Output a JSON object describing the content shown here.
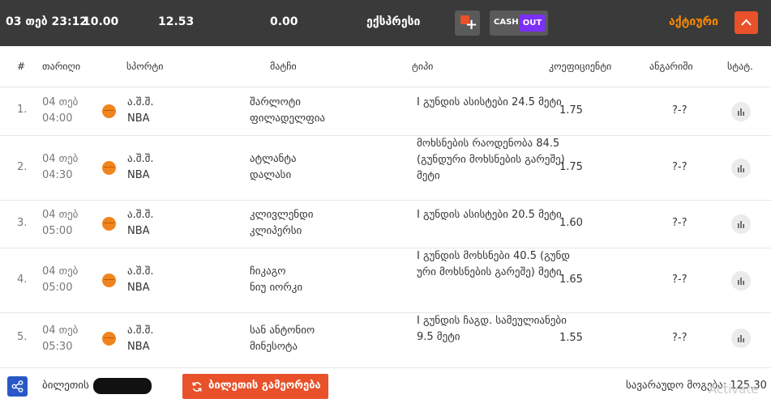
{
  "topbar": {
    "datetime": "03 თებ 23:12",
    "stake": "10.00",
    "odds": "12.53",
    "win": "0.00",
    "bet_type": "ექსპრესი",
    "cashout_cash": "CASH",
    "cashout_out": "OUT",
    "status": "აქტიური"
  },
  "table": {
    "headers": {
      "num": "#",
      "date": "თარიღი",
      "sport": "სპორტი",
      "match": "მატჩი",
      "type": "ტიპი",
      "coef": "კოეფიციენტი",
      "account": "ანგარიში",
      "stat": "სტატ."
    },
    "rows": [
      {
        "num": "1.",
        "date1": "04 თებ",
        "date2": "04:00",
        "country": "ა.შ.შ.",
        "league": "NBA",
        "team1": "შარლოტი",
        "team2": "ფილადელფია",
        "type": "I გუნდის ასისტები 24.5 მეტი",
        "coef": "1.75",
        "score": "?-?"
      },
      {
        "num": "2.",
        "date1": "04 თებ",
        "date2": "04:30",
        "country": "ა.შ.შ.",
        "league": "NBA",
        "team1": "ატლანტა",
        "team2": "დალასი",
        "type": "მოხსნების რაოდენობა 84.5 (გუნდური მოხსნების გარეშე) მეტი",
        "coef": "1.75",
        "score": "?-?"
      },
      {
        "num": "3.",
        "date1": "04 თებ",
        "date2": "05:00",
        "country": "ა.შ.შ.",
        "league": "NBA",
        "team1": "კლივლენდი",
        "team2": "კლიპერსი",
        "type": "I გუნდის ასისტები 20.5 მეტი",
        "coef": "1.60",
        "score": "?-?"
      },
      {
        "num": "4.",
        "date1": "04 თებ",
        "date2": "05:00",
        "country": "ა.შ.შ.",
        "league": "NBA",
        "team1": "ჩიკაგო",
        "team2": "ნიუ იორკი",
        "type": "I გუნდის მოხსნები 40.5 (გუნდური მოხსნების გარეშე) მეტი",
        "coef": "1.65",
        "score": "?-?"
      },
      {
        "num": "5.",
        "date1": "04 თებ",
        "date2": "05:30",
        "country": "ა.შ.შ.",
        "league": "NBA",
        "team1": "სან ანტონიო",
        "team2": "მინესოტა",
        "type": "I გუნდის ჩაგდ. სამეულიანები 9.5 მეტი",
        "coef": "1.55",
        "score": "?-?"
      }
    ]
  },
  "footer": {
    "ticket_label": "ბილეთის",
    "repeat_label": "ბილეთის გამეორება",
    "expected": "სავარაუდო მოგება: 125.30",
    "watermark": "Activate"
  },
  "colors": {
    "topbar_bg": "#3a3a3a",
    "accent_orange": "#e8512a",
    "status_orange": "#ff8a00",
    "cashout_purple": "#7b2ff7",
    "share_blue": "#2857c7",
    "ball_orange": "#f0841e"
  },
  "icons": {
    "plus": "plus-icon",
    "chevron": "chevron-up-icon",
    "stat": "bar-chart-icon",
    "share": "share-icon",
    "repeat": "refresh-icon",
    "sport": "basketball-icon"
  }
}
